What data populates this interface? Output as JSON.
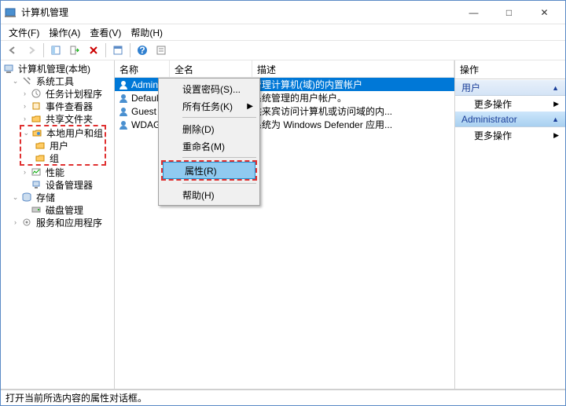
{
  "window": {
    "title": "计算机管理",
    "btn_min": "—",
    "btn_max": "□",
    "btn_close": "✕"
  },
  "menubar": {
    "file": "文件(F)",
    "action": "操作(A)",
    "view": "查看(V)",
    "help": "帮助(H)"
  },
  "tree": {
    "root": "计算机管理(本地)",
    "sys_tools": "系统工具",
    "task_sched": "任务计划程序",
    "event_viewer": "事件查看器",
    "shared": "共享文件夹",
    "local_users": "本地用户和组",
    "users": "用户",
    "groups": "组",
    "perf": "性能",
    "devmgr": "设备管理器",
    "storage": "存储",
    "diskmgr": "磁盘管理",
    "services": "服务和应用程序"
  },
  "list": {
    "col_name": "名称",
    "col_full": "全名",
    "col_desc": "描述",
    "rows": [
      {
        "name": "Administrat...",
        "full": "",
        "desc": "管理计算机(域)的内置帐户"
      },
      {
        "name": "DefaultAcc...",
        "full": "",
        "desc": "系统管理的用户帐户。"
      },
      {
        "name": "Guest",
        "full": "",
        "desc": "供来宾访问计算机或访问域的内..."
      },
      {
        "name": "WDAGUtil...",
        "full": "",
        "desc": "系统为 Windows Defender 应用..."
      }
    ]
  },
  "context": {
    "set_pw": "设置密码(S)...",
    "all_tasks": "所有任务(K)",
    "delete": "删除(D)",
    "rename": "重命名(M)",
    "props": "属性(R)",
    "help": "帮助(H)"
  },
  "actions": {
    "header": "操作",
    "group1": "用户",
    "more1": "更多操作",
    "group2": "Administrator",
    "more2": "更多操作"
  },
  "status": "打开当前所选内容的属性对话框。"
}
